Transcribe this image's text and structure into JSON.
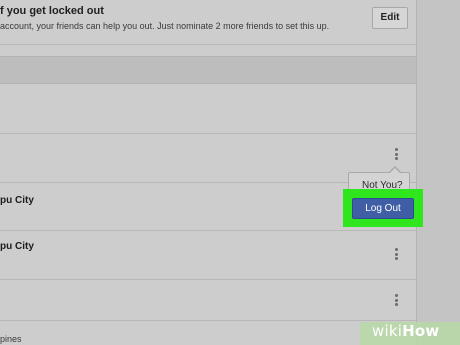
{
  "locked_out_section": {
    "title": "f you get locked out",
    "description": "account, your friends can help you out. Just nominate 2 more friends to set this up.",
    "edit_label": "Edit"
  },
  "sessions": {
    "rows": [
      {
        "label": ""
      },
      {
        "label": ""
      },
      {
        "label": "pu City"
      },
      {
        "label": "pu City"
      },
      {
        "label": ""
      },
      {
        "label": "pines"
      }
    ],
    "popover": {
      "not_you_label": "Not You?",
      "log_out_label": "Log Out"
    },
    "highlight_color": "#2ee51e",
    "button_color": "#3f5ea6"
  },
  "watermark": {
    "part1": "wiki",
    "part2": "How"
  }
}
